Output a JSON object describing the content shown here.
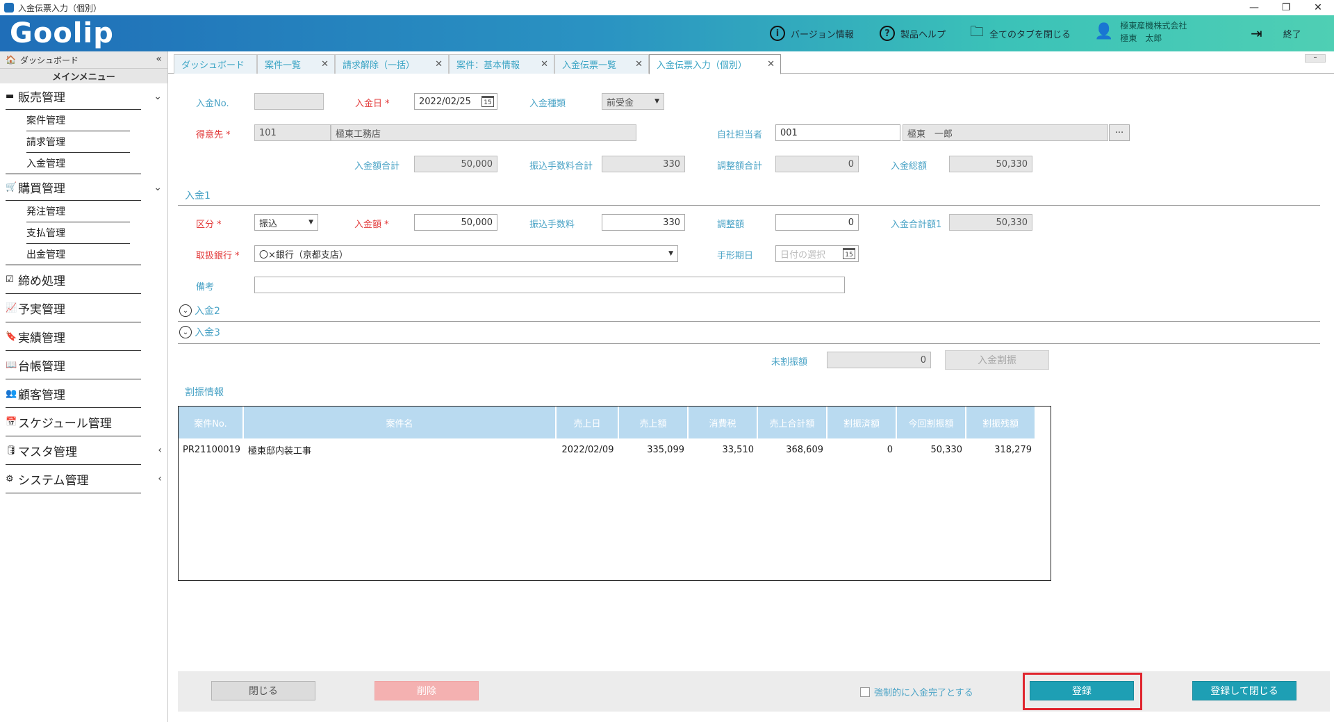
{
  "window": {
    "title": "入金伝票入力（個別）",
    "minimize": "—",
    "restore": "❐",
    "close": "✕"
  },
  "header": {
    "logo": "Goolip",
    "version": "バージョン情報",
    "help": "製品ヘルプ",
    "close_all": "全てのタブを閉じる",
    "company": "極東産機株式会社",
    "user": "極東　太郎",
    "exit": "終了"
  },
  "sidebar": {
    "dashboard": "ダッシュボード",
    "menu_title": "メインメニュー",
    "groups": [
      {
        "label": "販売管理",
        "subs": [
          "案件管理",
          "請求管理",
          "入金管理"
        ]
      },
      {
        "label": "購買管理",
        "subs": [
          "発注管理",
          "支払管理",
          "出金管理"
        ]
      },
      {
        "label": "締め処理"
      },
      {
        "label": "予実管理"
      },
      {
        "label": "実績管理"
      },
      {
        "label": "台帳管理"
      },
      {
        "label": "顧客管理"
      },
      {
        "label": "スケジュール管理"
      },
      {
        "label": "マスタ管理"
      },
      {
        "label": "システム管理"
      }
    ]
  },
  "tabs": [
    "ダッシュボード",
    "案件一覧",
    "請求解除（一括）",
    "案件：基本情報",
    "入金伝票一覧",
    "入金伝票入力（個別）"
  ],
  "form": {
    "nyukin_no_label": "入金No.",
    "nyukin_no": "",
    "nyukin_date_label": "入金日",
    "nyukin_date": "2022/02/25",
    "cal_day": "15",
    "nyukin_type_label": "入金種類",
    "nyukin_type": "前受金",
    "tokuisaki_label": "得意先",
    "tokuisaki_code": "101",
    "tokuisaki_name": "極東工務店",
    "tanto_label": "自社担当者",
    "tanto_code": "001",
    "tanto_name": "極東　一郎",
    "ellipsis": "···",
    "total_label": "入金額合計",
    "total": "50,000",
    "fee_total_label": "振込手数料合計",
    "fee_total": "330",
    "adj_total_label": "調整額合計",
    "adj_total": "0",
    "grand_label": "入金総額",
    "grand": "50,330",
    "section1": "入金1",
    "kubun_label": "区分",
    "kubun": "振込",
    "amount_label": "入金額",
    "amount": "50,000",
    "fee_label": "振込手数料",
    "fee": "330",
    "adj_label": "調整額",
    "adj": "0",
    "subtotal_label": "入金合計額1",
    "subtotal": "50,330",
    "bank_label": "取扱銀行",
    "bank": "〇×銀行（京都支店）",
    "tegata_label": "手形期日",
    "tegata_placeholder": "日付の選択",
    "biko_label": "備考",
    "biko": "",
    "section2": "入金2",
    "section3": "入金3",
    "mifuri_label": "未割振額",
    "mifuri": "0",
    "furiwake_btn": "入金割振",
    "wari_title": "割振情報"
  },
  "table": {
    "headers": [
      "案件No.",
      "案件名",
      "売上日",
      "売上額",
      "消費税",
      "売上合計額",
      "割振済額",
      "今回割振額",
      "割振残額"
    ],
    "rows": [
      [
        "PR21100019",
        "極東邸内装工事",
        "2022/02/09",
        "335,099",
        "33,510",
        "368,609",
        "0",
        "50,330",
        "318,279"
      ]
    ]
  },
  "footer": {
    "close": "閉じる",
    "delete": "削除",
    "force_label": "強制的に入金完了とする",
    "register": "登録",
    "register_close": "登録して閉じる"
  },
  "colors": {
    "accent": "#1e9fb4",
    "label": "#4aa3c6",
    "required": "#e23b3b",
    "highlight": "#e0252e"
  }
}
